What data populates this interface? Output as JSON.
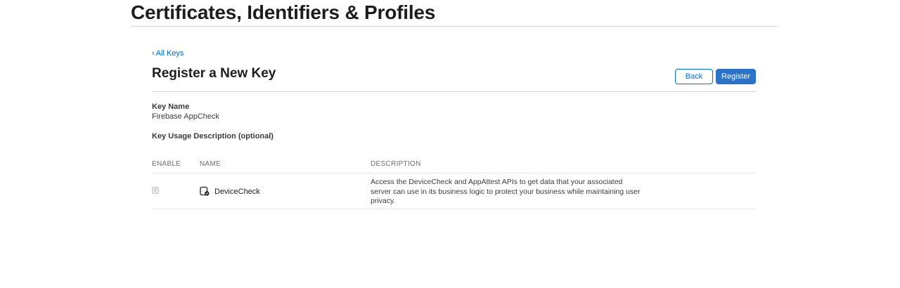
{
  "header": {
    "title": "Certificates, Identifiers & Profiles"
  },
  "nav": {
    "back_link_chevron": "‹",
    "back_link_label": "All Keys"
  },
  "form": {
    "title": "Register a New Key",
    "back_button": "Back",
    "register_button": "Register",
    "key_name_label": "Key Name",
    "key_name_value": "Firebase AppCheck",
    "key_usage_label": "Key Usage Description (optional)"
  },
  "table": {
    "columns": [
      "ENABLE",
      "NAME",
      "DESCRIPTION"
    ],
    "rows": [
      {
        "enabled": true,
        "enabled_disabled": true,
        "icon": "device-check-icon",
        "name": "DeviceCheck",
        "description": "Access the DeviceCheck and AppAttest APIs to get data that your associated server can use in its business logic to protect your business while maintaining user privacy."
      }
    ]
  },
  "colors": {
    "link": "#0066cc",
    "primary_button": "#2e72c7",
    "divider": "#d2d2d7"
  }
}
